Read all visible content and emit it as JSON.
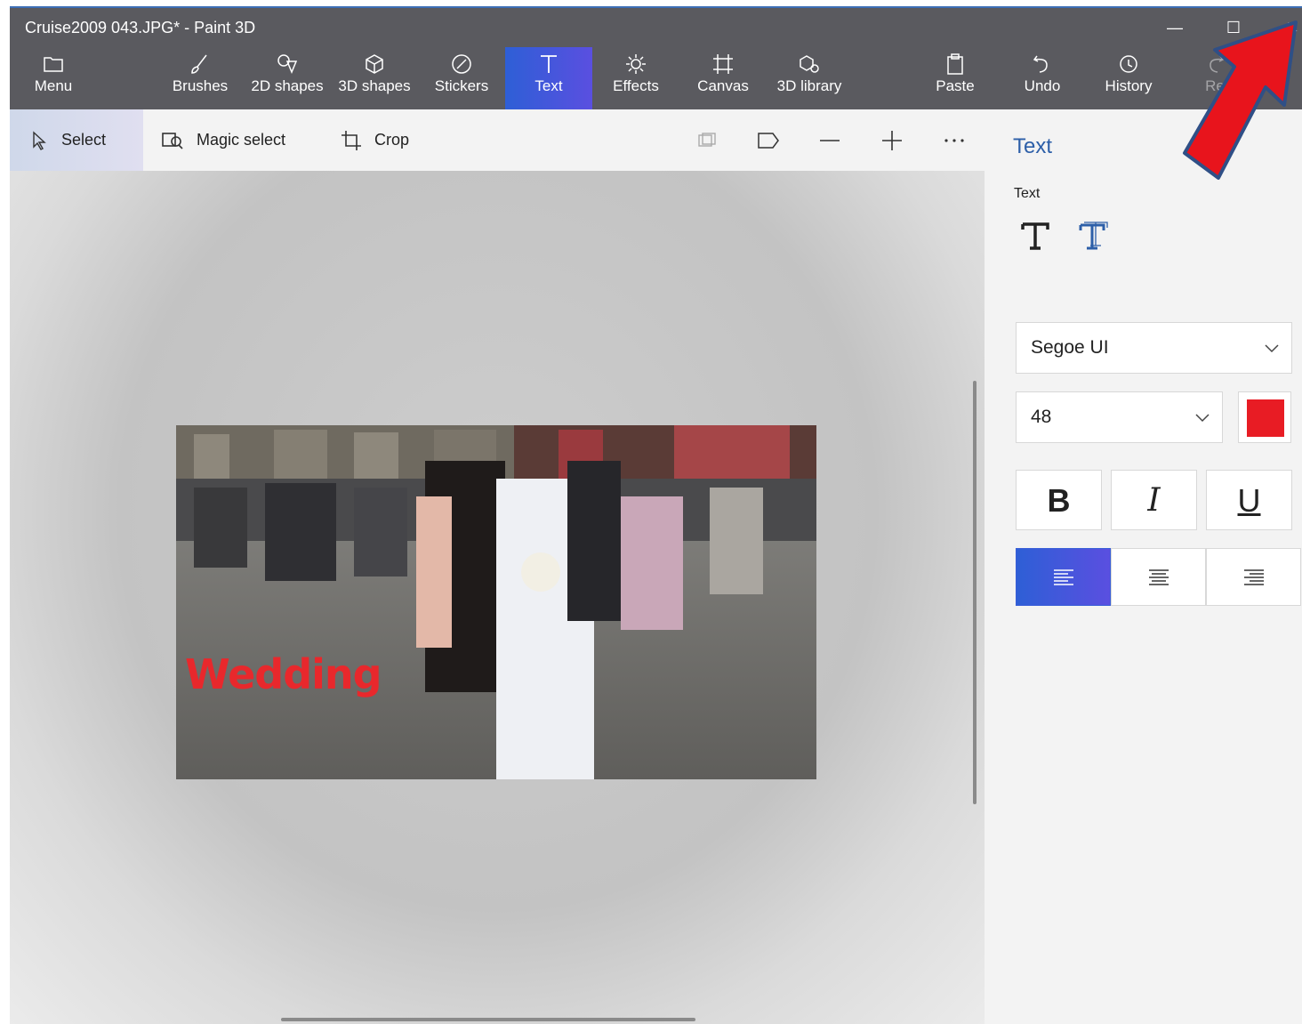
{
  "window": {
    "title": "Cruise2009 043.JPG* - Paint 3D",
    "controls": {
      "minimize": "—",
      "maximize": "☐",
      "close": "✕"
    }
  },
  "ribbon": {
    "tools": [
      {
        "label": "Menu",
        "icon": "folder-icon"
      },
      {
        "label": "Brushes",
        "icon": "brush-icon"
      },
      {
        "label": "2D shapes",
        "icon": "2d-shapes-icon"
      },
      {
        "label": "3D shapes",
        "icon": "3d-shapes-icon"
      },
      {
        "label": "Stickers",
        "icon": "sticker-icon"
      },
      {
        "label": "Text",
        "icon": "text-icon",
        "active": true
      },
      {
        "label": "Effects",
        "icon": "effects-icon"
      },
      {
        "label": "Canvas",
        "icon": "canvas-icon"
      },
      {
        "label": "3D library",
        "icon": "3d-library-icon"
      },
      {
        "label": "Paste",
        "icon": "paste-icon"
      },
      {
        "label": "Undo",
        "icon": "undo-icon"
      },
      {
        "label": "History",
        "icon": "history-icon"
      },
      {
        "label": "Re",
        "icon": "redo-icon"
      }
    ]
  },
  "subtoolbar": {
    "select": "Select",
    "magic_select": "Magic select",
    "crop": "Crop"
  },
  "canvas": {
    "photo_text": "Wedding"
  },
  "panel": {
    "title": "Text",
    "section_label": "Text",
    "font": "Segoe UI",
    "size": "48",
    "color": "#e81c24",
    "bold": "B",
    "italic": "I",
    "underline": "U",
    "alignment": "left"
  },
  "colors": {
    "accent": "#2e5fd6",
    "ribbon": "#5a5a5f",
    "arrow": "#e8141c"
  }
}
